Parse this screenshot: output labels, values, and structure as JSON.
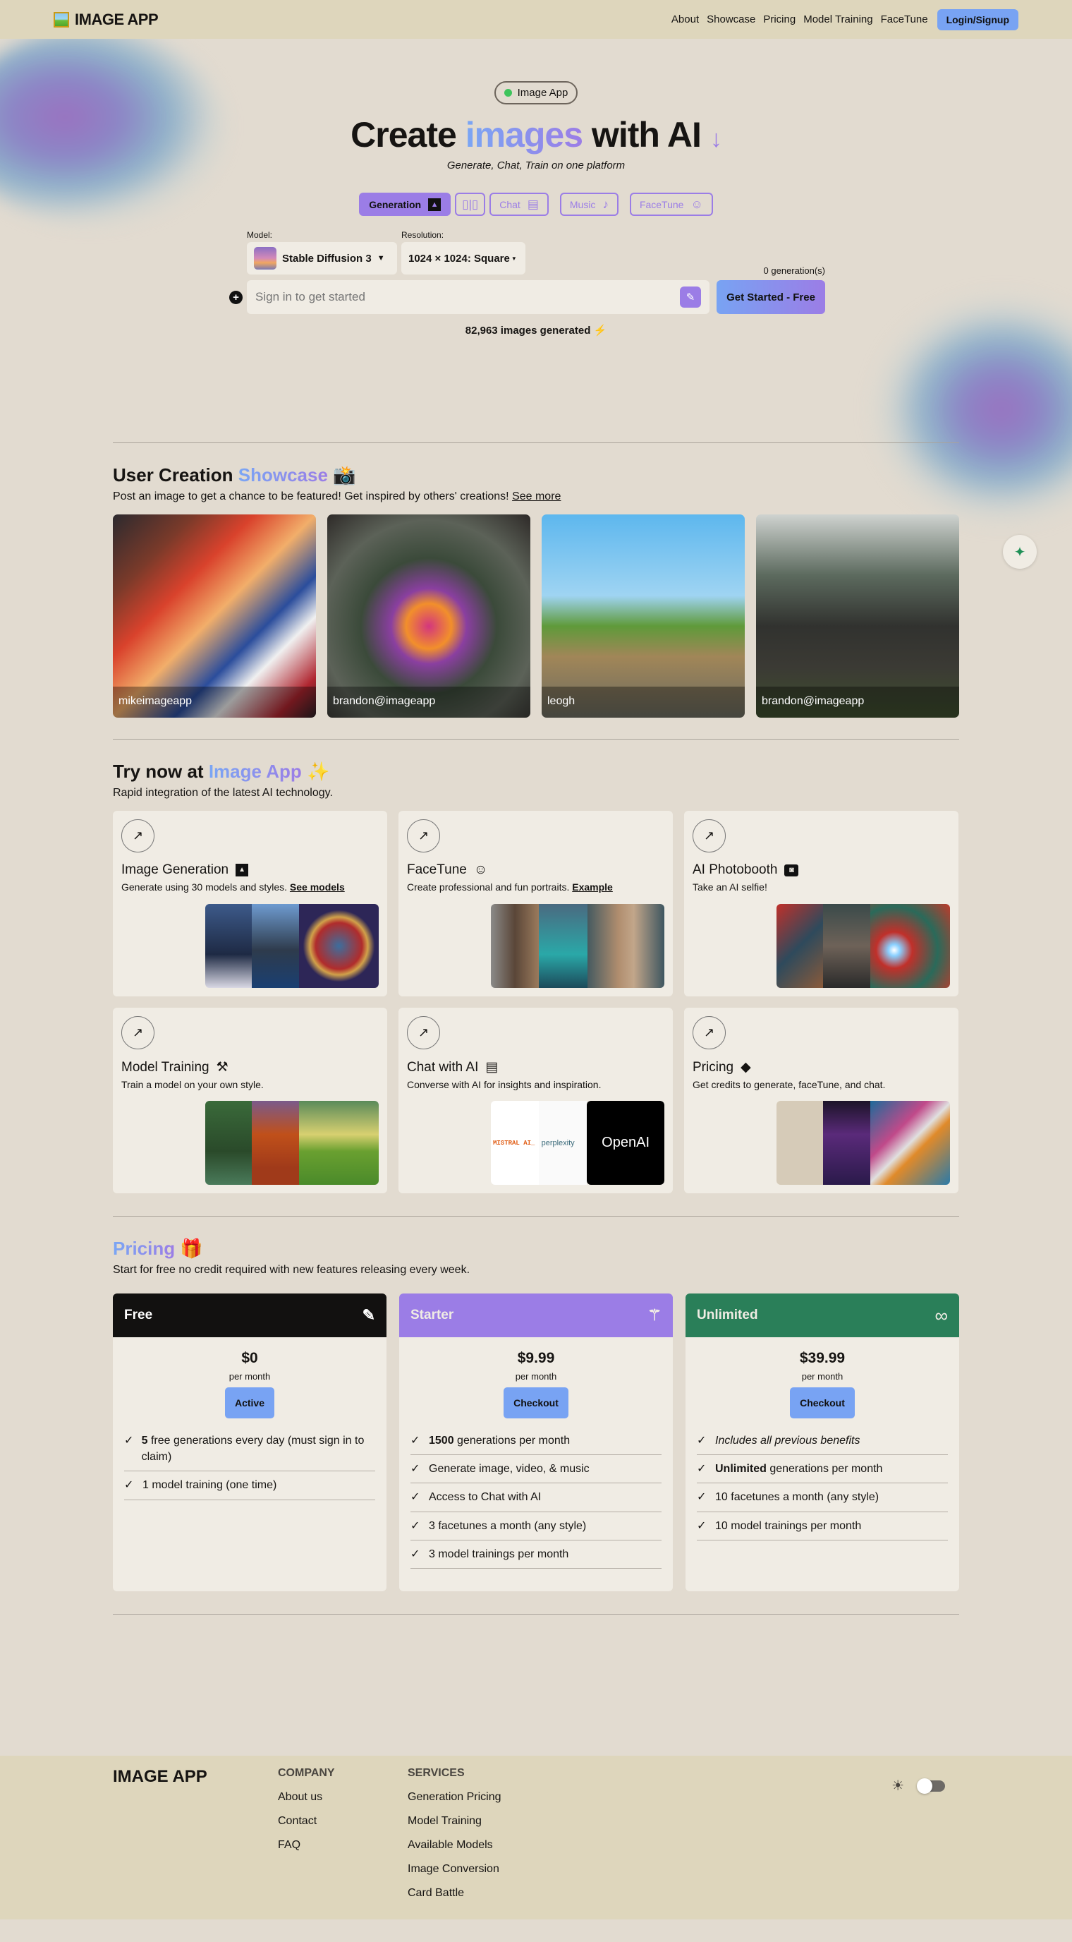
{
  "header": {
    "logo_text": "IMAGE APP",
    "nav": [
      "About",
      "Showcase",
      "Pricing",
      "Model Training",
      "FaceTune"
    ],
    "login_label": "Login/Signup"
  },
  "hero": {
    "badge": "Image App",
    "title_pre": "Create",
    "title_highlight": "images",
    "title_post": "with AI",
    "title_arrow": "↓",
    "subtitle": "Generate, Chat, Train on one platform",
    "modes": [
      {
        "label": "Generation",
        "icon": "▲",
        "active": true
      },
      {
        "label": "",
        "icon": "▯|▯",
        "active": false
      },
      {
        "label": "Chat",
        "icon": "▤",
        "active": false
      },
      {
        "label": "Music",
        "icon": "♪",
        "active": false
      },
      {
        "label": "FaceTune",
        "icon": "☺",
        "active": false
      }
    ],
    "model_label": "Model:",
    "model_value": "Stable Diffusion 3",
    "resolution_label": "Resolution:",
    "resolution_value": "1024 × 1024: Square",
    "generation_count": "0 generation(s)",
    "prompt_placeholder": "Sign in to get started",
    "cta_label": "Get Started - Free",
    "images_generated": "82,963 images generated",
    "bolt": "⚡"
  },
  "showcase": {
    "title_pre": "User Creation",
    "title_highlight": "Showcase",
    "title_emoji": "📸",
    "description": "Post an image to get a chance to be featured! Get inspired by others' creations!",
    "see_more": "See more",
    "items": [
      {
        "user": "mikeimageapp"
      },
      {
        "user": "brandon@imageapp"
      },
      {
        "user": "leogh"
      },
      {
        "user": "brandon@imageapp"
      }
    ]
  },
  "try_now": {
    "title_pre": "Try now at",
    "title_highlight": "Image App",
    "title_emoji": "✨",
    "description": "Rapid integration of the latest AI technology.",
    "cards": [
      {
        "title": "Image Generation",
        "icon": "▲",
        "desc": "Generate using 30 models and styles.",
        "link": "See models"
      },
      {
        "title": "FaceTune",
        "icon": "☺",
        "desc": "Create professional and fun portraits.",
        "link": "Example"
      },
      {
        "title": "AI Photobooth",
        "icon": "◙",
        "desc": "Take an AI selfie!",
        "link": ""
      },
      {
        "title": "Model Training",
        "icon": "⚒",
        "desc": "Train a model on your own style.",
        "link": ""
      },
      {
        "title": "Chat with AI",
        "icon": "▤",
        "desc": "Converse with AI for insights and inspiration.",
        "link": ""
      },
      {
        "title": "Pricing",
        "icon": "◆",
        "desc": "Get credits to generate, faceTune, and chat.",
        "link": ""
      }
    ],
    "chat_logos": [
      "MISTRAL AI_",
      "perplexity",
      "OpenAI"
    ],
    "arrow_glyph": "↗"
  },
  "pricing": {
    "title": "Pricing",
    "title_emoji": "🎁",
    "description": "Start for free no credit required with new features releasing every week.",
    "plans": [
      {
        "name": "Free",
        "icon": "✎",
        "color": "#121110",
        "price": "$0",
        "period": "per month",
        "button": "Active",
        "features": [
          {
            "bold": "5",
            "text": " free generations every day (must sign in to claim)"
          },
          {
            "bold": "",
            "text": "1 model training (one time)"
          }
        ]
      },
      {
        "name": "Starter",
        "icon": "⚚",
        "color": "#9b7de6",
        "price": "$9.99",
        "period": "per month",
        "button": "Checkout",
        "features": [
          {
            "bold": "1500",
            "text": " generations per month"
          },
          {
            "bold": "",
            "text": "Generate image, video, & music"
          },
          {
            "bold": "",
            "text": "Access to Chat with AI"
          },
          {
            "bold": "",
            "text": "3 facetunes a month (any style)"
          },
          {
            "bold": "",
            "text": "3 model trainings per month"
          }
        ]
      },
      {
        "name": "Unlimited",
        "icon": "∞",
        "color": "#2a7f59",
        "price": "$39.99",
        "period": "per month",
        "button": "Checkout",
        "features": [
          {
            "bold": "",
            "text": "Includes all previous benefits",
            "italic": true
          },
          {
            "bold": "Unlimited",
            "text": " generations per month"
          },
          {
            "bold": "",
            "text": "10 facetunes a month (any style)"
          },
          {
            "bold": "",
            "text": "10 model trainings per month"
          }
        ]
      }
    ]
  },
  "footer": {
    "logo": "IMAGE APP",
    "company_heading": "COMPANY",
    "company_links": [
      "About us",
      "Contact",
      "FAQ"
    ],
    "services_heading": "SERVICES",
    "services_links": [
      "Generation Pricing",
      "Model Training",
      "Available Models",
      "Image Conversion",
      "Card Battle"
    ],
    "theme_icon": "☀"
  },
  "colors": {
    "background": "#e2dbd0",
    "header": "#ded6bc",
    "accent_blue": "#78a3f3",
    "accent_purple": "#9b7de6",
    "accent_green": "#2a7f59"
  }
}
